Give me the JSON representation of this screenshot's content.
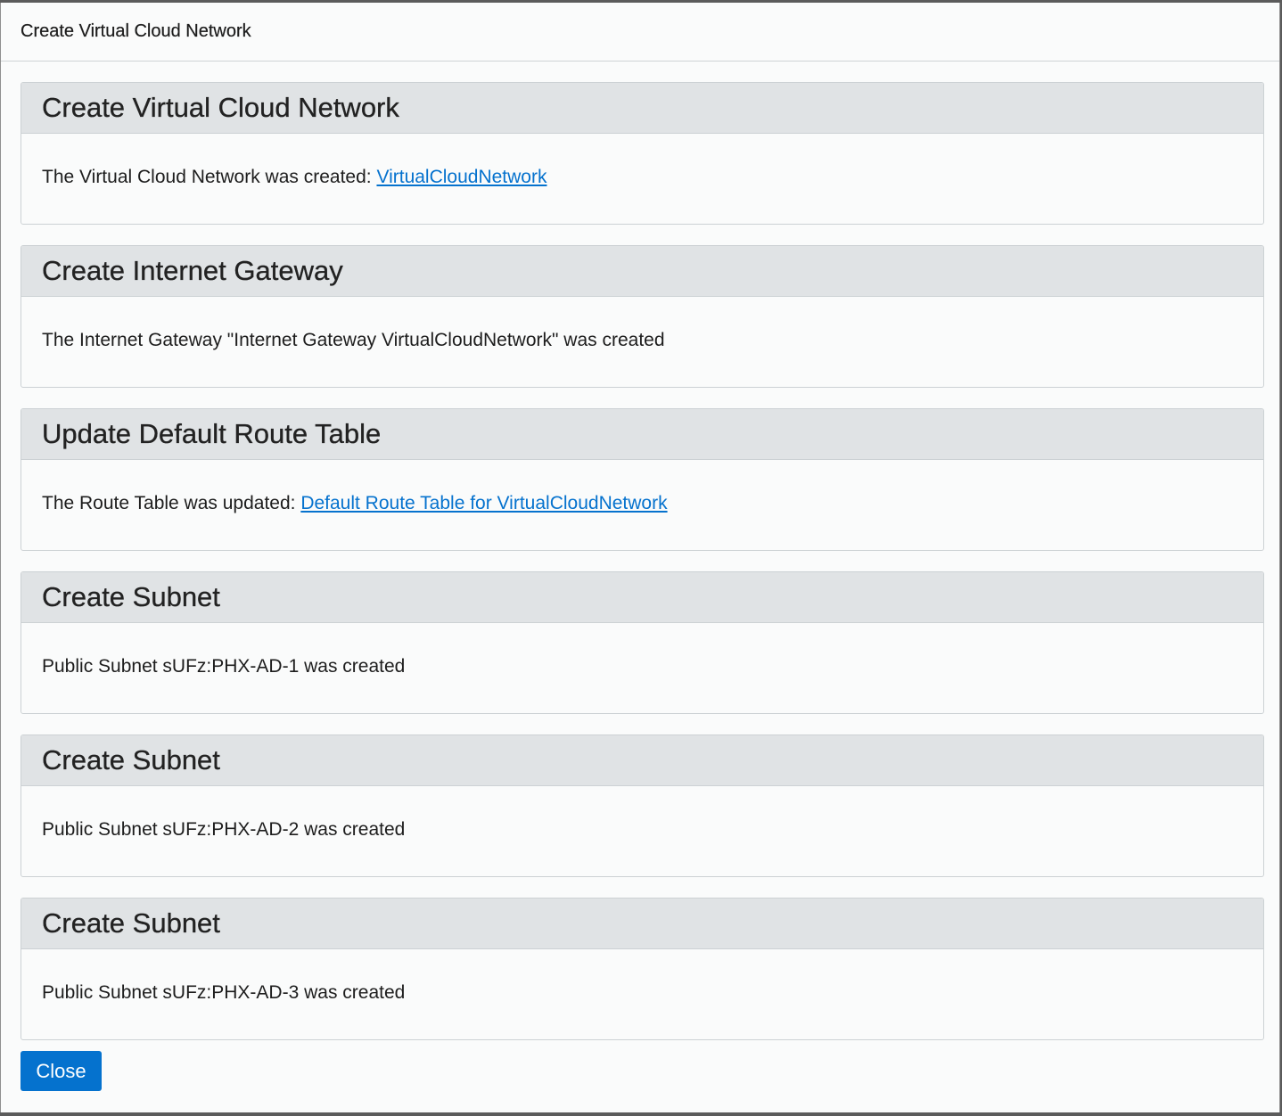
{
  "dialog": {
    "title": "Create Virtual Cloud Network"
  },
  "panels": [
    {
      "title": "Create Virtual Cloud Network",
      "text": "The Virtual Cloud Network was created: ",
      "link": "VirtualCloudNetwork"
    },
    {
      "title": "Create Internet Gateway",
      "text": "The Internet Gateway \"Internet Gateway VirtualCloudNetwork\" was created",
      "link": ""
    },
    {
      "title": "Update Default Route Table",
      "text": "The Route Table was updated: ",
      "link": "Default Route Table for VirtualCloudNetwork"
    },
    {
      "title": "Create Subnet",
      "text": "Public Subnet sUFz:PHX-AD-1 was created",
      "link": ""
    },
    {
      "title": "Create Subnet",
      "text": "Public Subnet sUFz:PHX-AD-2 was created",
      "link": ""
    },
    {
      "title": "Create Subnet",
      "text": "Public Subnet sUFz:PHX-AD-3 was created",
      "link": ""
    }
  ],
  "footer": {
    "close_label": "Close"
  },
  "colors": {
    "accent": "#0572ce",
    "panel_heading_bg": "#e0e3e5",
    "dialog_bg": "#fafbfb"
  }
}
